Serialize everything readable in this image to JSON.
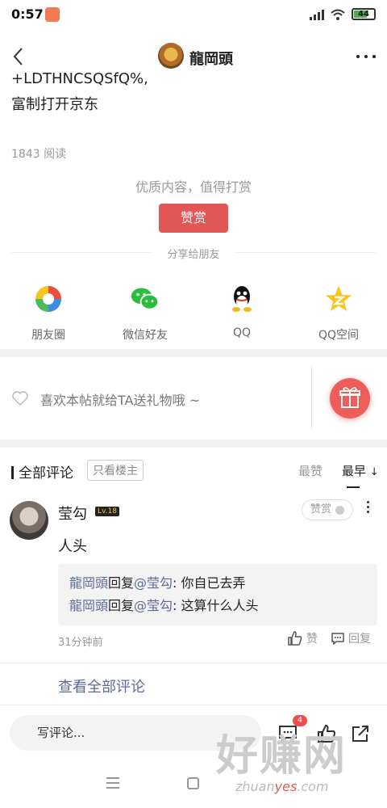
{
  "status_bar": {
    "time": "0:57",
    "battery": "44"
  },
  "header": {
    "author_name": "龍岡頭"
  },
  "article": {
    "line1": "+LDTHNCSQSfQ%,",
    "line2": "富制打开京东",
    "read_count": "1843 阅读"
  },
  "reward": {
    "hint": "优质内容，值得打赏",
    "button_label": "赞赏"
  },
  "share": {
    "label": "分享给朋友",
    "items": [
      {
        "label": "朋友圈",
        "icon": "moments-icon"
      },
      {
        "label": "微信好友",
        "icon": "wechat-icon"
      },
      {
        "label": "QQ",
        "icon": "qq-icon"
      },
      {
        "label": "QQ空间",
        "icon": "qzone-icon"
      }
    ]
  },
  "gift": {
    "text": "喜欢本帖就给TA送礼物哦 ~"
  },
  "comments": {
    "title": "全部评论",
    "only_op": "只看楼主",
    "sort_hot": "最赞",
    "sort_new": "最早",
    "items": [
      {
        "user": "莹勾",
        "level": "Lv.18",
        "reward_label": "赞赏",
        "body": "人头",
        "replies": [
          {
            "from": "龍岡頭",
            "verb": "回复",
            "to": "@莹勾",
            "text": ": 你自已去弄"
          },
          {
            "from": "龍岡頭",
            "verb": "回复",
            "to": "@莹勾",
            "text": ": 这算什么人头"
          }
        ],
        "time": "31分钟前",
        "like_label": "赞",
        "reply_label": "回复"
      }
    ],
    "see_all": "查看全部评论"
  },
  "bottom_bar": {
    "write_placeholder": "写评论...",
    "comment_badge": "4"
  },
  "watermark": {
    "big": "好赚网",
    "url_a": "zhuan",
    "url_b": "yes",
    "url_c": ".com"
  },
  "colors": {
    "accent_red": "#e25655",
    "link_blue": "#5a6c98"
  }
}
